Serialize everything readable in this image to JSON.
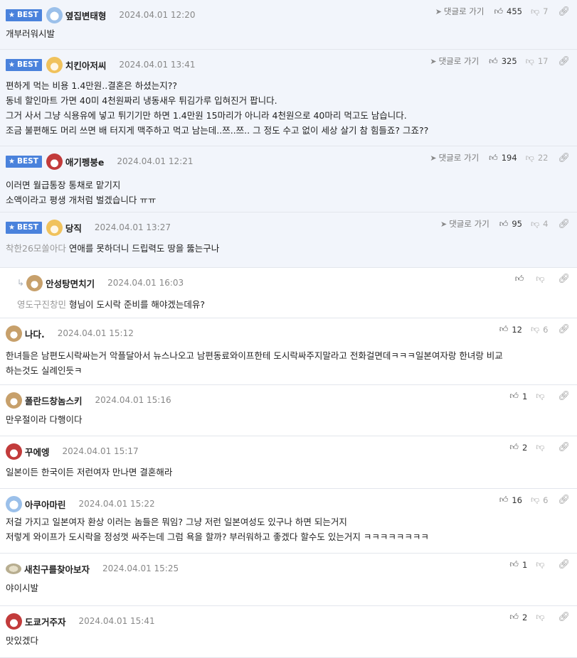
{
  "labels": {
    "best": "BEST",
    "goto": "댓글로 가기"
  },
  "comments": [
    {
      "nick": "옆집변태형",
      "date": "2024.04.01 12:20",
      "likes": "455",
      "dislikes": "7",
      "lines": [
        "개부러워시발"
      ]
    },
    {
      "nick": "치킨아저씨",
      "date": "2024.04.01 13:41",
      "likes": "325",
      "dislikes": "17",
      "lines": [
        "편하게 먹는 비용 1.4만원..결혼은 하셨는지??",
        "동네 할인마트 가면 40미 4천원짜리 냉동새우 튀김가루 입혀진거 팝니다.",
        "그거 사서 그냥 식용유에 넣고 튀기기만 하면 1.4만원 15마리가 아니라 4천원으로 40마리 먹고도 남습니다.",
        "조금 불편해도 머리 쓰면 배 터지게 맥주하고 먹고 남는데..쯔..쯔.. 그 정도 수고 없이 세상 살기 참 힘들죠? 그죠??"
      ]
    },
    {
      "nick": "애기펭붕e",
      "date": "2024.04.01 12:21",
      "likes": "194",
      "dislikes": "22",
      "lines": [
        "이러면 월급통장 통채로 맡기지",
        "소액이라고 평생 개처럼 벌겠습니다 ㅠㅠ"
      ]
    },
    {
      "nick": "당직",
      "date": "2024.04.01 13:27",
      "likes": "95",
      "dislikes": "4",
      "mention": "착한26모쏠아다",
      "lines": [
        "연애를 못하더니 드립력도 땅을 뚫는구나"
      ]
    },
    {
      "nick": "안성탕면치기",
      "date": "2024.04.01 16:03",
      "likes": "",
      "dislikes": "",
      "mention": "영도구진창민",
      "lines": [
        "형님이 도시락 준비를 해야겠는데유?"
      ]
    },
    {
      "nick": "나다.",
      "date": "2024.04.01 15:12",
      "likes": "12",
      "dislikes": "6",
      "lines": [
        "한녀들은 남편도시락싸는거 악플달아서 뉴스나오고 남편동료와이프한테 도시락싸주지말라고 전화걸면데ㅋㅋㅋ일본여자랑 한녀랑 비교",
        "하는것도 실례인듯ㅋ"
      ]
    },
    {
      "nick": "폴란드창놈스키",
      "date": "2024.04.01 15:16",
      "likes": "1",
      "dislikes": "",
      "lines": [
        "만우절이라 다행이다"
      ]
    },
    {
      "nick": "꾸에엥",
      "date": "2024.04.01 15:17",
      "likes": "2",
      "dislikes": "",
      "lines": [
        "일본이든 한국이든 저런여자 만나면 결혼해라"
      ]
    },
    {
      "nick": "아쿠아마린",
      "date": "2024.04.01 15:22",
      "likes": "16",
      "dislikes": "6",
      "lines": [
        "저걸 가지고 일본여자 환상 이러는 놈들은 뭐임? 그냥 저런 일본여성도 있구나 하면 되는거지",
        "저렇게 와이프가 도시락을 정성껏 싸주는데 그럼 욕을 할까? 부러워하고 좋겠다 할수도 있는거지 ㅋㅋㅋㅋㅋㅋㅋㅋ"
      ]
    },
    {
      "nick": "새친구를찾아보자",
      "date": "2024.04.01 15:25",
      "likes": "1",
      "dislikes": "",
      "lines": [
        "야이시발"
      ]
    },
    {
      "nick": "도쿄거주자",
      "date": "2024.04.01 15:41",
      "likes": "2",
      "dislikes": "",
      "lines": [
        "맛있겠다"
      ]
    }
  ]
}
